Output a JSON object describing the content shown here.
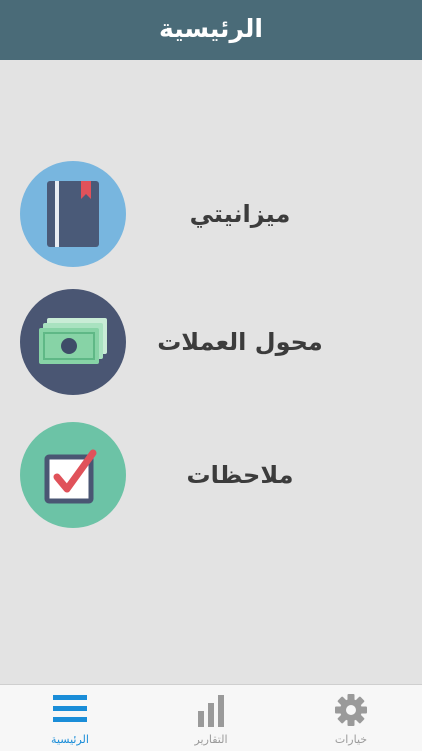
{
  "header": {
    "title": "الرئيسية"
  },
  "menu": [
    {
      "label": "ميزانيتي",
      "icon": "budget-book-icon",
      "color": "#78b6df"
    },
    {
      "label": "محول العملات",
      "icon": "money-bills-icon",
      "color": "#4a5673"
    },
    {
      "label": "ملاحظات",
      "icon": "checkbox-icon",
      "color": "#6cc3a6"
    }
  ],
  "tabbar": {
    "tabs": [
      {
        "label": "الرئيسية",
        "icon": "hamburger-menu-icon",
        "active": true
      },
      {
        "label": "التقارير",
        "icon": "bar-chart-icon",
        "active": false
      },
      {
        "label": "خيارات",
        "icon": "gear-icon",
        "active": false
      }
    ],
    "active_color": "#1a8dd8"
  }
}
